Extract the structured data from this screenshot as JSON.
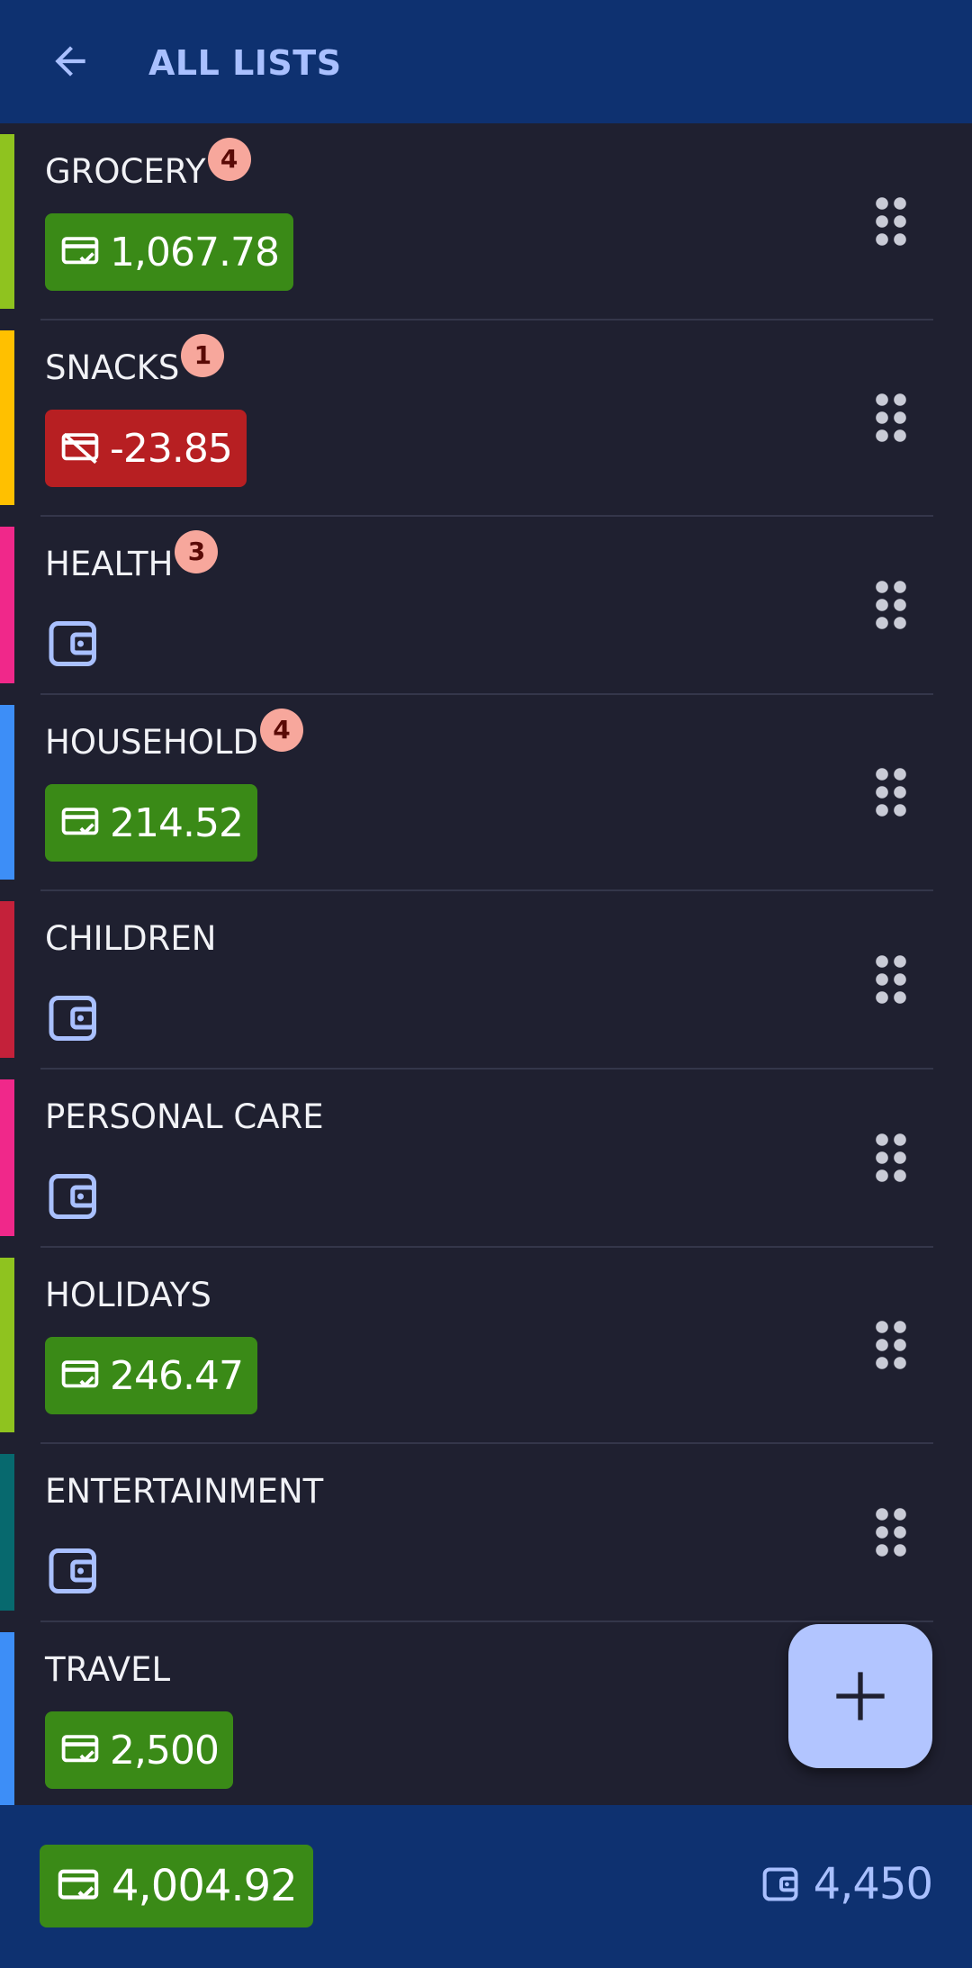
{
  "appbar": {
    "title": "ALL LISTS",
    "back_icon": "arrow-left-icon"
  },
  "colors": {
    "appbar_bg": "#0e3170",
    "body_bg": "#1f2030",
    "positive_chip": "#3a8a17",
    "negative_chip": "#b71f22",
    "badge_bg": "#f7a79c",
    "accent": "#a9c0ff"
  },
  "lists": [
    {
      "name": "GROCERY",
      "badge": "4",
      "color": "#8fc31f",
      "amount": "1,067.78",
      "status": "positive"
    },
    {
      "name": "SNACKS",
      "badge": "1",
      "color": "#ffc000",
      "amount": "-23.85",
      "status": "negative"
    },
    {
      "name": "HEALTH",
      "badge": "3",
      "color": "#f0288a",
      "amount": "",
      "status": "none"
    },
    {
      "name": "HOUSEHOLD",
      "badge": "4",
      "color": "#3d8ef7",
      "amount": "214.52",
      "status": "positive"
    },
    {
      "name": "CHILDREN",
      "badge": "",
      "color": "#c4213a",
      "amount": "",
      "status": "none"
    },
    {
      "name": "PERSONAL CARE",
      "badge": "",
      "color": "#f0288a",
      "amount": "",
      "status": "none"
    },
    {
      "name": "HOLIDAYS",
      "badge": "",
      "color": "#8fc31f",
      "amount": "246.47",
      "status": "positive"
    },
    {
      "name": "ENTERTAINMENT",
      "badge": "",
      "color": "#07696e",
      "amount": "",
      "status": "none"
    },
    {
      "name": "TRAVEL",
      "badge": "",
      "color": "#3d8ef7",
      "amount": "2,500",
      "status": "positive"
    }
  ],
  "fab": {
    "icon": "plus-icon"
  },
  "footer": {
    "spent_total": "4,004.92",
    "budget_total": "4,450"
  }
}
